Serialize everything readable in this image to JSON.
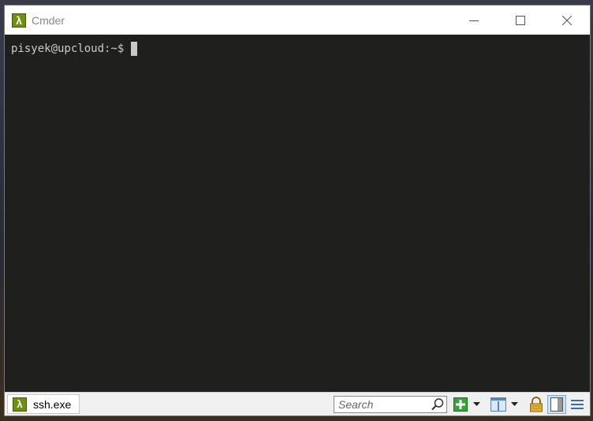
{
  "window": {
    "title": "Cmder",
    "app_icon_glyph": "λ"
  },
  "terminal": {
    "prompt": "pisyek@upcloud:~$",
    "text_color": "#c9c9c9",
    "background": "#1f201d"
  },
  "statusbar": {
    "tabs": [
      {
        "label": "ssh.exe",
        "icon_glyph": "λ"
      }
    ],
    "search_placeholder": "Search",
    "icons": [
      "search-icon",
      "new-console-icon",
      "dropdown-icon",
      "split-pane-icon",
      "dropdown-icon",
      "lock-icon",
      "panel-icon",
      "menu-icon"
    ]
  },
  "colors": {
    "accent": "#6e8f12",
    "new_console_green": "#3aa23a"
  }
}
